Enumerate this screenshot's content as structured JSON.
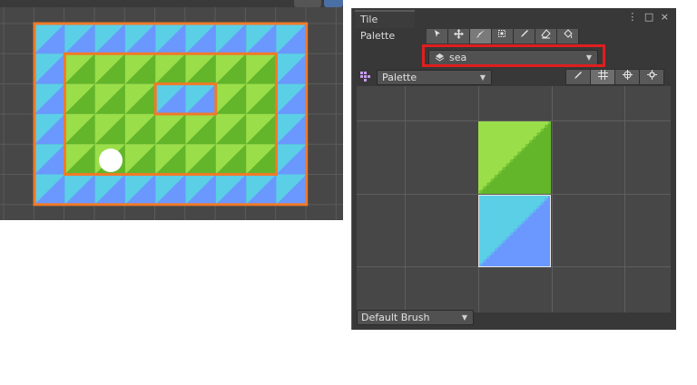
{
  "scene": {
    "colors": {
      "sea_blue": "#6a98ff",
      "sea_cyan": "#5bcfe6",
      "grass_dark": "#63b52a",
      "grass_light": "#9ade4a",
      "outline": "#f07a28"
    }
  },
  "palette_window": {
    "title": "Tile Palette",
    "window_controls": "⋮ □ ×",
    "tools": [
      "select",
      "move",
      "paint",
      "box-fill",
      "pick",
      "erase",
      "fill"
    ],
    "active_tool": "paint",
    "active_tilemap": "sea",
    "palette_name": "Palette",
    "brush": "Default Brush",
    "tiles": [
      {
        "name": "grass-tile",
        "colors": [
          "#9ade4a",
          "#63b52a"
        ]
      },
      {
        "name": "sea-tile",
        "colors": [
          "#5bcfe6",
          "#6a98ff"
        ]
      }
    ]
  }
}
